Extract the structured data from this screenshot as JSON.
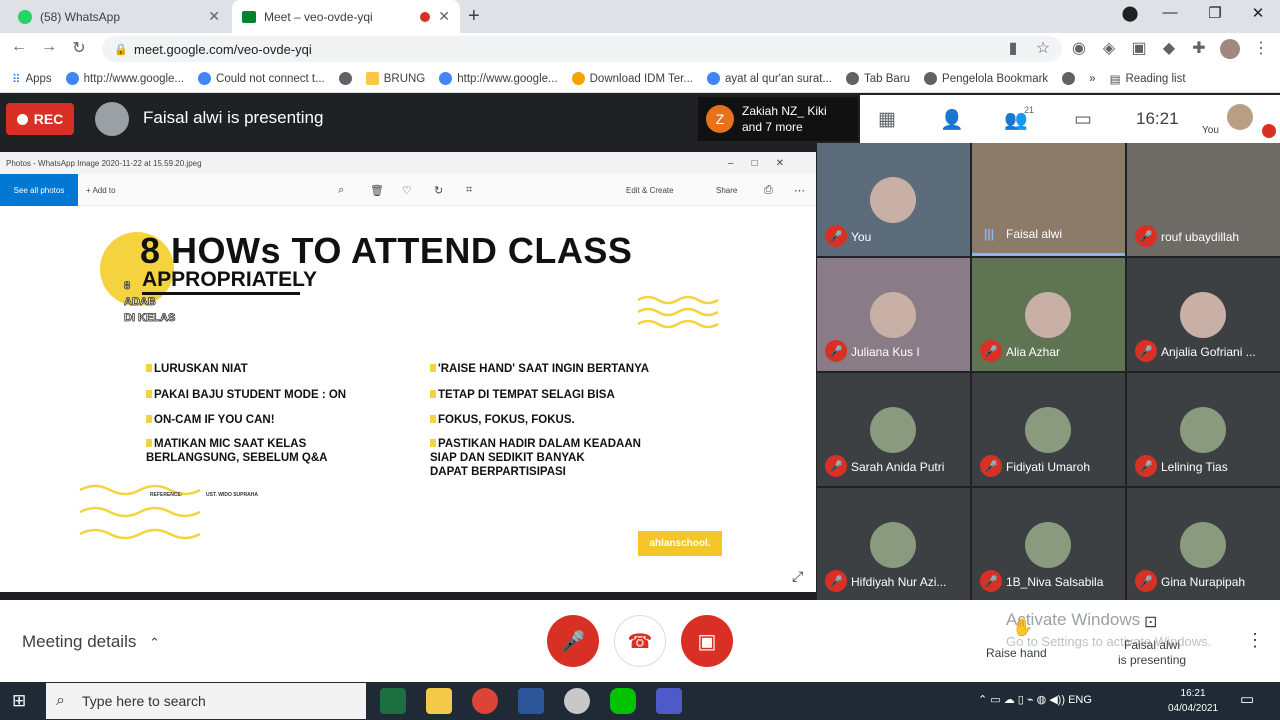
{
  "browser": {
    "tabs": [
      {
        "label": "(58) WhatsApp"
      },
      {
        "label": "Meet – veo-ovde-yqi"
      }
    ],
    "new_tab": "+",
    "url": "meet.google.com/veo-ovde-yqi",
    "bookmarks": [
      "Apps",
      "http://www.google...",
      "Could not connect t...",
      "BRUNG",
      "http://www.google...",
      "Download IDM Ter...",
      "ayat al qur'an surat...",
      "Tab Baru",
      "Pengelola Bookmark",
      "»",
      "Reading list"
    ]
  },
  "meet": {
    "rec_label": "REC",
    "presenting_text": "Faisal alwi is presenting",
    "join_initial": "Z",
    "join_line1": "Zakiah NZ_ Kiki",
    "join_line2": "and 7 more",
    "people_count": "21",
    "time": "16:21",
    "self_label": "You"
  },
  "photo_viewer": {
    "title": "Photos - WhatsApp Image 2020-11-22 at 15.59.20.jpeg",
    "see_all": "See all photos",
    "add_to": "+ Add to",
    "edit_create": "Edit & Create",
    "share": "Share"
  },
  "slide": {
    "title": "8 HOWs TO ATTEND CLASS",
    "subtitle": "APPROPRIATELY",
    "side_lines": [
      "8",
      "ADAB",
      "DI KELAS"
    ],
    "left_items": [
      "LURUSKAN NIAT",
      "PAKAI BAJU STUDENT MODE : ON",
      "ON-CAM IF YOU CAN!",
      "MATIKAN MIC SAAT KELAS\nBERLANGSUNG, SEBELUM Q&A"
    ],
    "right_items": [
      "'RAISE HAND' SAAT INGIN BERTANYA",
      "TETAP DI TEMPAT SELAGI BISA",
      "FOKUS, FOKUS, FOKUS.",
      "PASTIKAN HADIR DALAM KEADAAN\nSIAP DAN SEDIKIT BANYAK\nDAPAT BERPARTISIPASI"
    ],
    "reference_label": "REFERENCE:",
    "reference_value": "UST. WIDO SUPRAHA",
    "logo": "ahlanschool."
  },
  "participants": [
    {
      "name": "You",
      "muted": true,
      "color": "#5c6b7a"
    },
    {
      "name": "Faisal alwi",
      "muted": false,
      "color": "#8d7b6a"
    },
    {
      "name": "rouf ubaydillah",
      "muted": true,
      "color": "#6e6a66"
    },
    {
      "name": "Juliana Kus I",
      "muted": true,
      "color": "#8a7c86"
    },
    {
      "name": "Alia Azhar",
      "muted": true,
      "color": "#5f7452"
    },
    {
      "name": "Anjalia Gofriani ...",
      "muted": true,
      "color": "#3c4043"
    },
    {
      "name": "Sarah Anida Putri",
      "muted": true,
      "color": "#3c4043"
    },
    {
      "name": "Fidiyati Umaroh",
      "muted": true,
      "color": "#3c4043"
    },
    {
      "name": "Lelining Tias",
      "muted": true,
      "color": "#3c4043"
    },
    {
      "name": "Hifdiyah Nur Azi...",
      "muted": true,
      "color": "#3c4043"
    },
    {
      "name": "1B_Niva Salsabila",
      "muted": true,
      "color": "#3c4043"
    },
    {
      "name": "Gina Nurapipah",
      "muted": true,
      "color": "#3c4043"
    }
  ],
  "controls": {
    "meeting_details": "Meeting details",
    "raise_hand": "Raise hand",
    "presenting_line1": "Faisal alwi",
    "presenting_line2": "is presenting",
    "activate_line1": "Activate Windows",
    "activate_line2": "Go to Settings to activate Windows."
  },
  "taskbar": {
    "search_placeholder": "Type here to search",
    "lang": "ENG",
    "time": "16:21",
    "date": "04/04/2021"
  },
  "colors": {
    "accent_red": "#d93025",
    "slide_yellow": "#f5d33f"
  }
}
